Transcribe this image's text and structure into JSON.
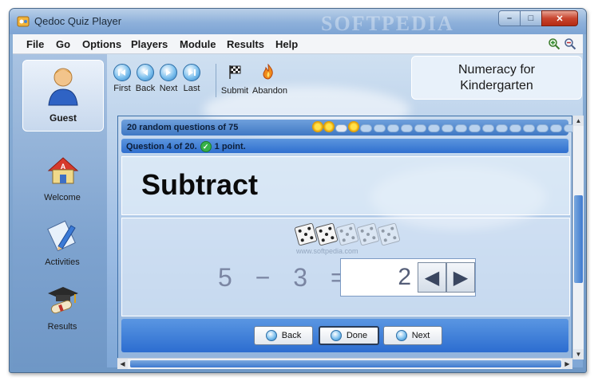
{
  "window": {
    "title": "Qedoc Quiz Player",
    "watermark": "SOFTPEDIA",
    "controls": {
      "minimize": "–",
      "maximize": "□",
      "close": "✕"
    }
  },
  "menu": [
    "File",
    "Go",
    "Options",
    "Players",
    "Module",
    "Results",
    "Help"
  ],
  "sidebar": {
    "user": "Guest",
    "items": [
      {
        "label": "Welcome",
        "icon": "house-icon"
      },
      {
        "label": "Activities",
        "icon": "pencil-icon"
      },
      {
        "label": "Results",
        "icon": "graduation-cap-icon"
      }
    ]
  },
  "toolbar": {
    "first": "First",
    "back": "Back",
    "next": "Next",
    "last": "Last",
    "submit": "Submit",
    "abandon": "Abandon"
  },
  "module_title": {
    "line1": "Numeracy for",
    "line2": "Kindergarten"
  },
  "quiz": {
    "summary": "20 random questions of 75",
    "progress_icons": [
      "sun",
      "sun",
      "cloud-sun",
      "sun",
      "cloud",
      "cloud",
      "cloud",
      "cloud",
      "cloud",
      "cloud",
      "cloud",
      "cloud",
      "cloud",
      "cloud",
      "cloud",
      "cloud",
      "cloud",
      "cloud",
      "cloud",
      "cloud"
    ],
    "question_status": "Question 4 of 20.",
    "points": "1 point.",
    "heading": "Subtract",
    "dice_total": 5,
    "dice_active": 2,
    "watermark_text": "www.softpedia.com",
    "expression": "5 − 3 =",
    "answer": "2",
    "buttons": {
      "back": "Back",
      "done": "Done",
      "next": "Next"
    }
  },
  "colors": {
    "accent": "#3f78c4",
    "panel_bar": "#2c6dd0",
    "close": "#c8452e"
  }
}
